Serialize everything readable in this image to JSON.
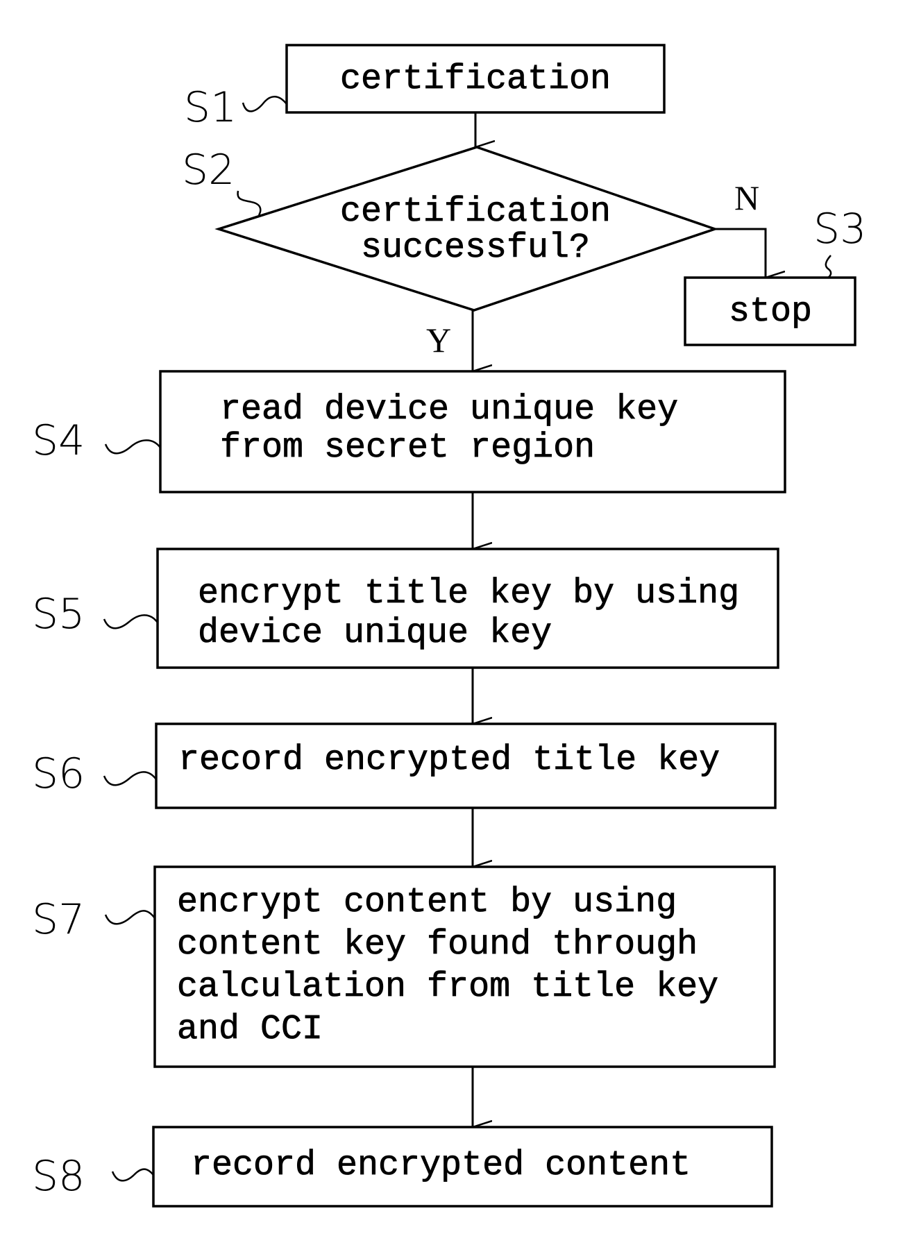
{
  "diagram": {
    "type": "flowchart",
    "colors": {
      "ink": "#000000",
      "background": "#ffffff"
    },
    "steps": [
      {
        "id": "S1",
        "label": "S1",
        "shape": "process",
        "lines": [
          "certification"
        ]
      },
      {
        "id": "S2",
        "label": "S2",
        "shape": "decision",
        "lines": [
          "certification",
          "successful?"
        ]
      },
      {
        "id": "S3",
        "label": "S3",
        "shape": "process",
        "lines": [
          "stop"
        ]
      },
      {
        "id": "S4",
        "label": "S4",
        "shape": "process",
        "lines": [
          "read device unique key",
          "from secret region"
        ]
      },
      {
        "id": "S5",
        "label": "S5",
        "shape": "process",
        "lines": [
          "encrypt title key by using",
          "device unique key"
        ]
      },
      {
        "id": "S6",
        "label": "S6",
        "shape": "process",
        "lines": [
          "record encrypted title key"
        ]
      },
      {
        "id": "S7",
        "label": "S7",
        "shape": "process",
        "lines": [
          "encrypt content by using",
          "content key found through",
          "calculation from title key",
          "and CCI"
        ]
      },
      {
        "id": "S8",
        "label": "S8",
        "shape": "process",
        "lines": [
          "record encrypted content"
        ]
      }
    ],
    "branches": {
      "yes_label": "Y",
      "no_label": "N"
    },
    "edges": [
      {
        "from": "S1",
        "to": "S2"
      },
      {
        "from": "S2",
        "to": "S3",
        "label": "N"
      },
      {
        "from": "S2",
        "to": "S4",
        "label": "Y"
      },
      {
        "from": "S4",
        "to": "S5"
      },
      {
        "from": "S5",
        "to": "S6"
      },
      {
        "from": "S6",
        "to": "S7"
      },
      {
        "from": "S7",
        "to": "S8"
      }
    ]
  }
}
